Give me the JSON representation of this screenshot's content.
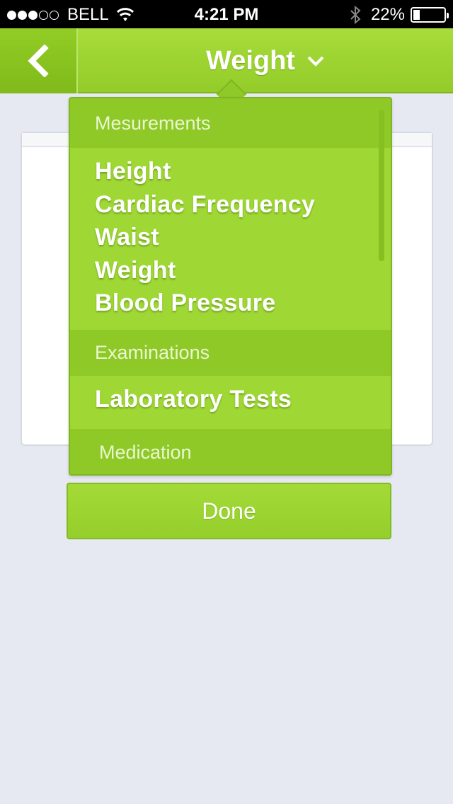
{
  "status_bar": {
    "carrier": "BELL",
    "time": "4:21 PM",
    "battery_percent": "22%",
    "battery_level": 0.22,
    "signal_bars_filled": 3,
    "signal_bars_total": 5
  },
  "nav": {
    "title": "Weight",
    "back_icon": "chevron-left-icon",
    "title_icon": "chevron-down-icon"
  },
  "dropdown": {
    "sections": [
      {
        "header": "Mesurements",
        "items": [
          "Height",
          "Cardiac Frequency",
          "Waist",
          "Weight",
          "Blood Pressure"
        ]
      },
      {
        "header": "Examinations",
        "items": [
          "Laboratory Tests"
        ]
      },
      {
        "header": "Medication",
        "items": []
      }
    ]
  },
  "done_button": {
    "label": "Done"
  },
  "colors": {
    "accent_green": "#9fd835",
    "section_green": "#8ec928",
    "background": "#e6e9f2"
  }
}
